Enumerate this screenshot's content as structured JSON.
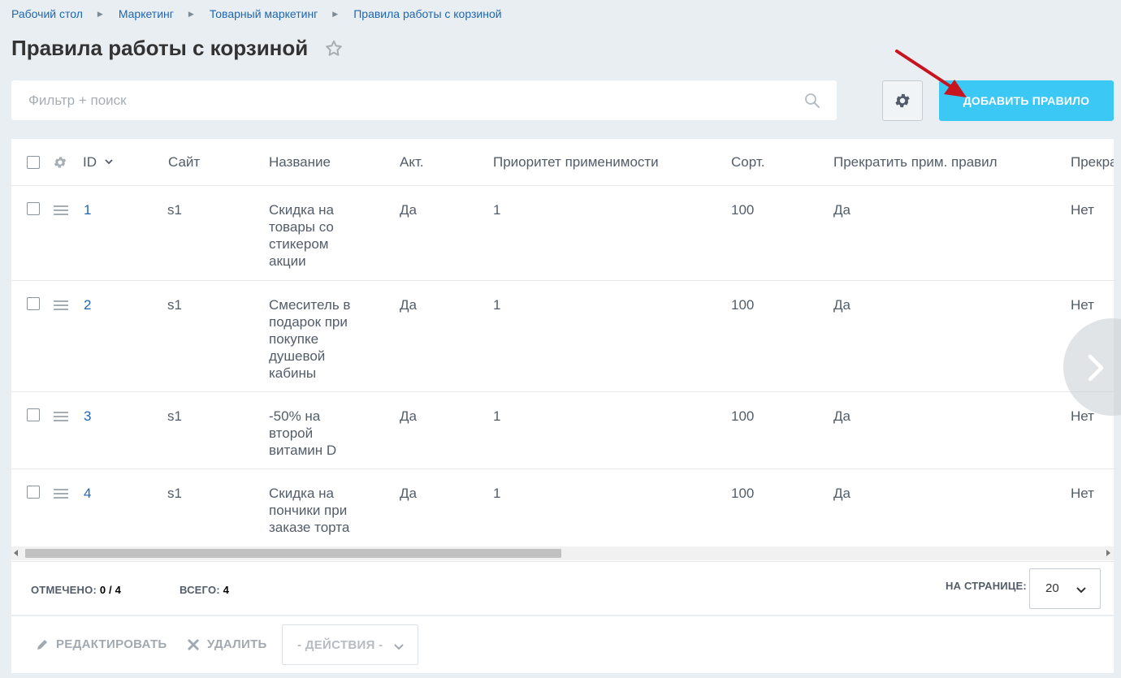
{
  "breadcrumb": [
    "Рабочий стол",
    "Маркетинг",
    "Товарный маркетинг",
    "Правила работы с корзиной"
  ],
  "page_title": "Правила работы с корзиной",
  "filter": {
    "placeholder": "Фильтр + поиск",
    "value": ""
  },
  "add_button_label": "ДОБАВИТЬ ПРАВИЛО",
  "colors": {
    "accent": "#3bc8f5",
    "link": "#2067b0",
    "annotation_arrow": "#c8141e"
  },
  "grid": {
    "columns": [
      "ID",
      "Сайт",
      "Название",
      "Акт.",
      "Приоритет применимости",
      "Сорт.",
      "Прекратить прим. правил",
      "Прекра"
    ],
    "sort_indicator_icon": "chevron-down-icon",
    "rows": [
      {
        "id": "1",
        "site": "s1",
        "name": "Скидка на товары со стикером акции",
        "active": "Да",
        "priority": "1",
        "sort": "100",
        "stop": "Да",
        "stop2": "Нет"
      },
      {
        "id": "2",
        "site": "s1",
        "name": "Смеситель в подарок при покупке душевой кабины",
        "active": "Да",
        "priority": "1",
        "sort": "100",
        "stop": "Да",
        "stop2": "Нет"
      },
      {
        "id": "3",
        "site": "s1",
        "name": "-50% на второй витамин D",
        "active": "Да",
        "priority": "1",
        "sort": "100",
        "stop": "Да",
        "stop2": "Нет"
      },
      {
        "id": "4",
        "site": "s1",
        "name": "Скидка на пончики при заказе торта",
        "active": "Да",
        "priority": "1",
        "sort": "100",
        "stop": "Да",
        "stop2": "Нет"
      }
    ]
  },
  "footer": {
    "selected_label": "ОТМЕЧЕНО:",
    "selected_value": "0 / 4",
    "total_label": "ВСЕГО:",
    "total_value": "4",
    "per_page_label": "НА СТРАНИЦЕ:",
    "per_page_value": "20"
  },
  "actions": {
    "edit_label": "РЕДАКТИРОВАТЬ",
    "delete_label": "УДАЛИТЬ",
    "select_placeholder": "- ДЕЙСТВИЯ -"
  }
}
